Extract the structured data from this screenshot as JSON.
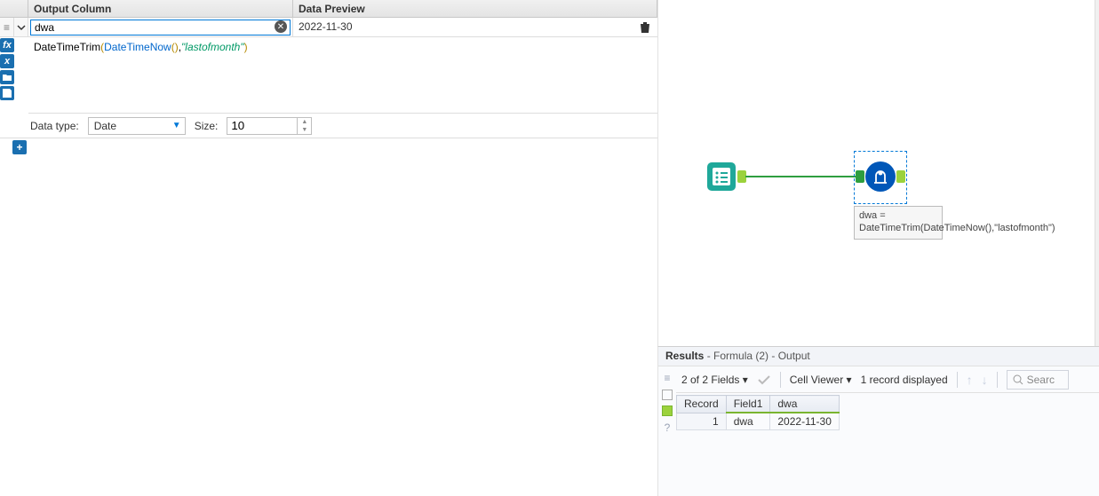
{
  "headers": {
    "output": "Output Column",
    "preview": "Data Preview"
  },
  "field": {
    "name": "dwa",
    "preview": "2022-11-30"
  },
  "expression": {
    "fn1": "DateTimeTrim",
    "fn2": "DateTimeNow",
    "str": "\"lastofmonth\""
  },
  "datatype": {
    "label": "Data type:",
    "value": "Date",
    "size_label": "Size:",
    "size": "10"
  },
  "canvas": {
    "formula_label": "dwa = DateTimeTrim(DateTimeNow(),\"lastofmonth\")"
  },
  "results": {
    "title": "Results",
    "subtitle": "- Formula (2) - Output",
    "fields_sel": "2 of 2 Fields",
    "cellviewer": "Cell Viewer",
    "records": "1 record displayed",
    "search_ph": "Searc",
    "cols": {
      "record": "Record",
      "field1": "Field1",
      "dwa": "dwa"
    },
    "row": {
      "record": "1",
      "field1": "dwa",
      "dwa": "2022-11-30"
    }
  }
}
